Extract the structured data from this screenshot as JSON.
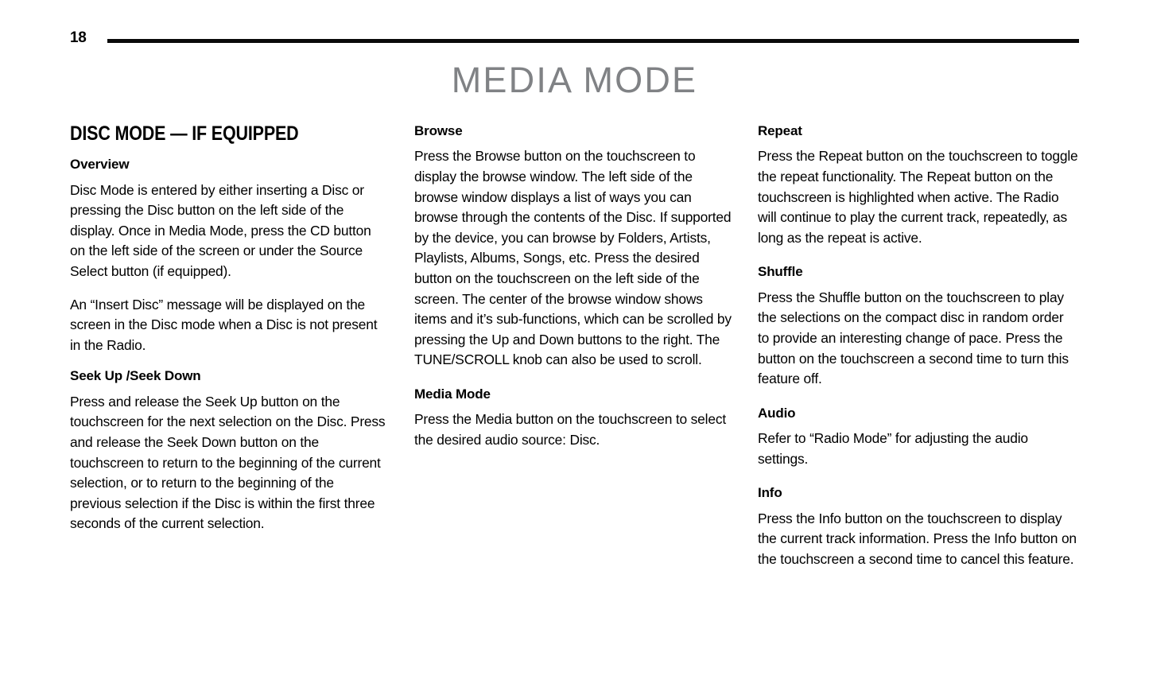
{
  "header": {
    "page_number": "18",
    "title": "MEDIA MODE",
    "rule_color": "#0a0a0a",
    "title_color": "#808285"
  },
  "columns": [
    {
      "id": "column-left",
      "blocks": [
        {
          "type": "section-title",
          "text": "DISC MODE — IF EQUIPPED"
        },
        {
          "type": "subhead",
          "text": "Overview"
        },
        {
          "type": "body",
          "text": "Disc Mode is entered by either inserting a Disc or pressing the Disc button on the left side of the display. Once in Media Mode, press the CD button on the left side of the screen or under the Source Select button (if equipped)."
        },
        {
          "type": "body",
          "text": "An “Insert Disc” message will be displayed on the screen in the Disc mode when a Disc is not present in the Radio."
        },
        {
          "type": "subhead",
          "text": "Seek Up /Seek Down"
        },
        {
          "type": "body",
          "text": "Press and release the Seek Up button on the touchscreen for the next selection on the Disc. Press and release the Seek Down button on the touchscreen to return to the beginning of the current selection, or to return to the beginning of the previous selection if the Disc is within the first three seconds of the current selection."
        }
      ]
    },
    {
      "id": "column-middle",
      "blocks": [
        {
          "type": "subhead",
          "text": "Browse"
        },
        {
          "type": "body",
          "text": "Press the Browse button on the touchscreen to display the browse window. The left side of the browse window displays a list of ways you can browse through the contents of the Disc. If supported by the device, you can browse by Folders, Artists, Playlists, Albums, Songs, etc. Press the desired button on the touchscreen on the left side of the screen. The center of the browse window shows items and it’s sub-functions, which can be scrolled by pressing the Up and Down buttons to the right. The TUNE/SCROLL knob can also be used to scroll."
        },
        {
          "type": "subhead",
          "text": "Media Mode"
        },
        {
          "type": "body",
          "text": "Press the Media button on the touchscreen to select the desired audio source: Disc."
        }
      ]
    },
    {
      "id": "column-right",
      "blocks": [
        {
          "type": "subhead",
          "text": "Repeat"
        },
        {
          "type": "body",
          "text": "Press the Repeat button on the touchscreen to toggle the repeat functionality. The Repeat button on the touchscreen is highlighted when active. The Radio will continue to play the current track, repeatedly, as long as the repeat is active."
        },
        {
          "type": "subhead",
          "text": "Shuffle"
        },
        {
          "type": "body",
          "text": "Press the Shuffle button on the touchscreen to play the selections on the compact disc in random order to provide an interesting change of pace. Press the button on the touchscreen a second time to turn this feature off."
        },
        {
          "type": "subhead",
          "text": "Audio"
        },
        {
          "type": "body",
          "text": "Refer to “Radio Mode” for adjusting the audio settings."
        },
        {
          "type": "subhead",
          "text": "Info"
        },
        {
          "type": "body",
          "text": "Press the Info button on the touchscreen to display the current track information. Press the Info button on the touchscreen a second time to cancel this feature."
        }
      ]
    }
  ]
}
